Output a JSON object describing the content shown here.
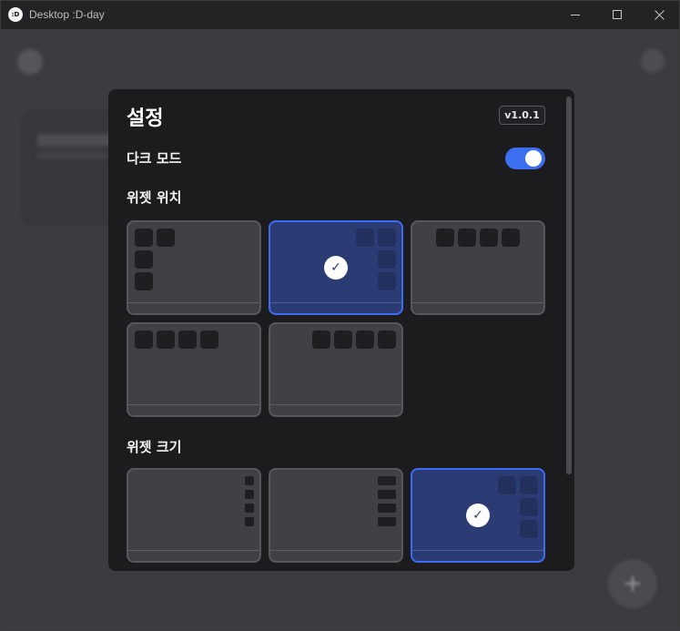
{
  "window": {
    "app_icon_text": ":D",
    "title": "Desktop :D-day",
    "minimize_icon": "minimize-icon",
    "maximize_icon": "maximize-icon",
    "close_icon": "close-icon"
  },
  "background": {
    "left_icon": "gear-icon",
    "right_icon": "gear-icon",
    "fab_label": "+"
  },
  "settings": {
    "title": "설정",
    "version": "v1.0.1",
    "dark_mode_label": "다크 모드",
    "dark_mode_on": true,
    "widget_position_label": "위젯 위치",
    "widget_position_selected": 1,
    "widget_size_label": "위젯 크기",
    "widget_size_selected": 2,
    "check_icon": "check-icon",
    "check_glyph": "✓"
  },
  "colors": {
    "accent": "#3d6cf0",
    "selected_tile": "#2b3b73",
    "toggle_on": "#3b6ff0"
  }
}
